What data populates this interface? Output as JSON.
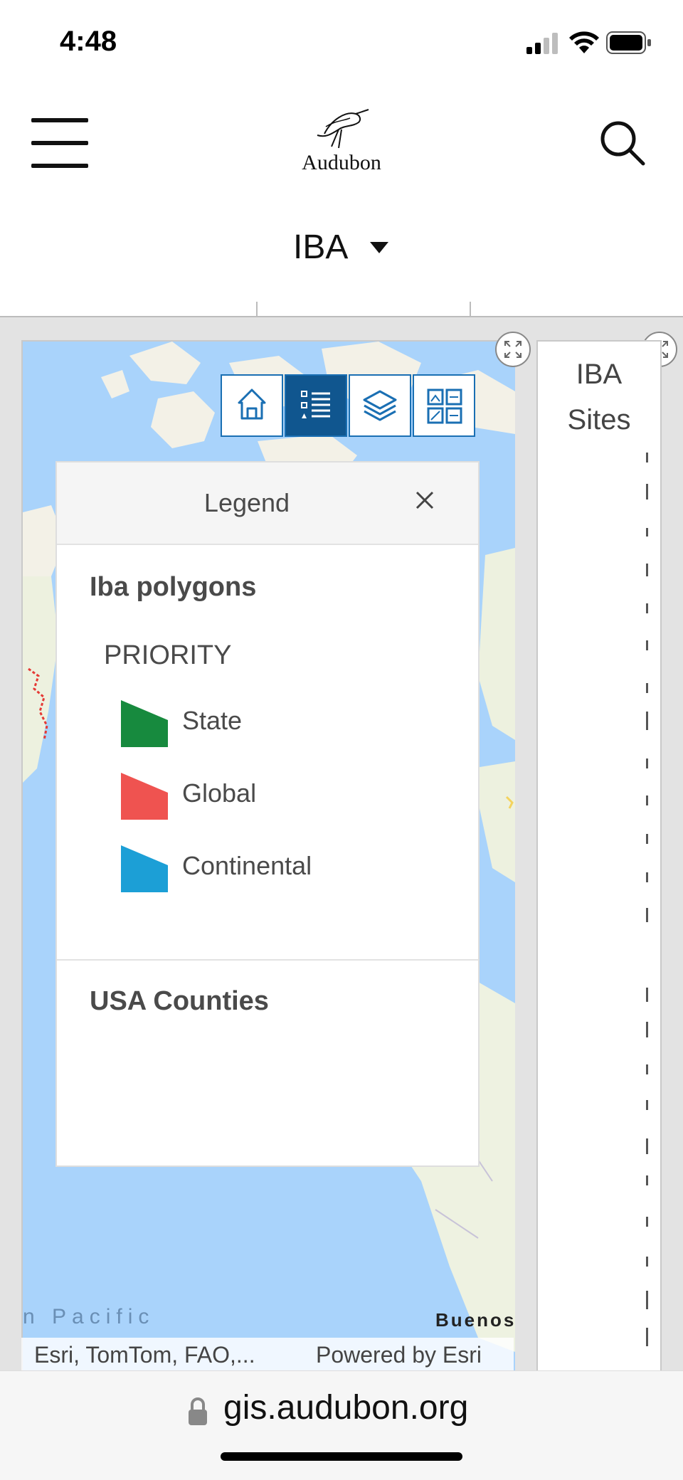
{
  "status_bar": {
    "time": "4:48"
  },
  "header": {
    "brand": "Audubon",
    "dropdown_title": "IBA"
  },
  "map": {
    "toolbar": [
      "home-icon",
      "legend-icon",
      "layers-icon",
      "basemap-gallery-icon"
    ],
    "label_ocean": "n  Pacific",
    "label_city": "Buenos",
    "attribution": "Esri, TomTom, FAO,...",
    "powered_by": "Powered by Esri"
  },
  "legend": {
    "title": "Legend",
    "layer1": "Iba polygons",
    "field": "PRIORITY",
    "items": [
      {
        "label": "State",
        "color": "#178a3e"
      },
      {
        "label": "Global",
        "color": "#ef5350"
      },
      {
        "label": "Continental",
        "color": "#1c9fd6"
      }
    ],
    "layer2": "USA Counties"
  },
  "side_panel": {
    "title_line1": "IBA",
    "title_line2": "Sites"
  },
  "url_bar": {
    "url": "gis.audubon.org"
  }
}
